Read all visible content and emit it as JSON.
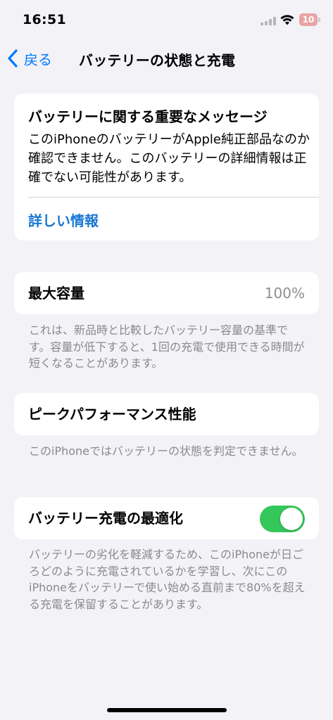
{
  "status_bar": {
    "time": "16:51",
    "battery_level": "10",
    "battery_color": "#e8a5a3"
  },
  "nav": {
    "back_label": "戻る",
    "title": "バッテリーの状態と充電"
  },
  "message_card": {
    "title": "バッテリーに関する重要なメッセージ",
    "body": "このiPhoneのバッテリーがApple純正部品なのか確認できません。このバッテリーの詳細情報は正確でない可能性があります。",
    "link_label": "詳しい情報"
  },
  "max_capacity": {
    "label": "最大容量",
    "value": "100%",
    "footnote": "これは、新品時と比較したバッテリー容量の基準です。容量が低下すると、1回の充電で使用できる時間が短くなることがあります。"
  },
  "peak_performance": {
    "label": "ピークパフォーマンス性能",
    "footnote": "このiPhoneではバッテリーの状態を判定できません。"
  },
  "optimized_charging": {
    "label": "バッテリー充電の最適化",
    "enabled": true,
    "toggle_color": "#34c759",
    "footnote": "バッテリーの劣化を軽減するため、このiPhoneが日ごろどのように充電されているかを学習し、次にこのiPhoneをバッテリーで使い始める直前まで80%を超える充電を保留することがあります。"
  },
  "colors": {
    "accent": "#007aff",
    "background": "#f2f2f7"
  }
}
